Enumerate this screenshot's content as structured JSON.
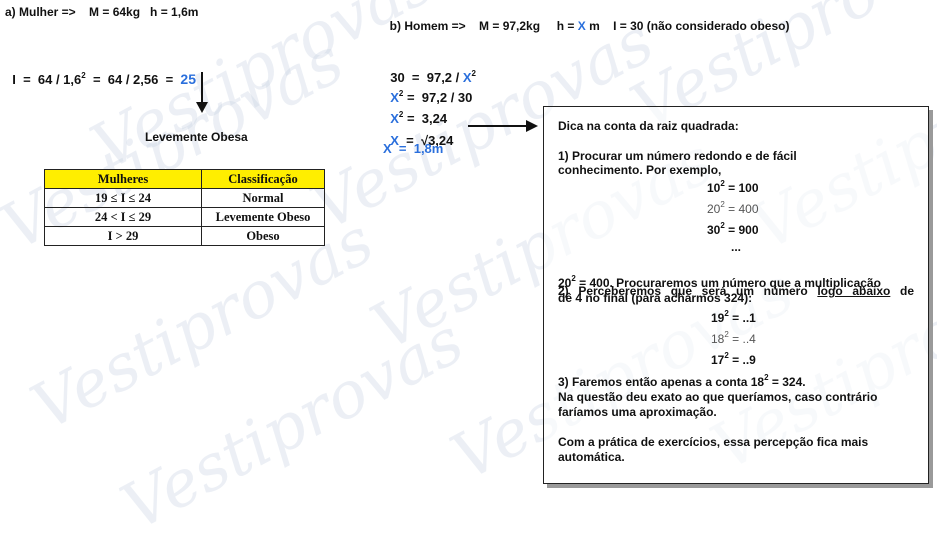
{
  "watermark": "Vestiprovas",
  "part_a": {
    "header": "a) Mulher =>    M = 64kg   h = 1,6m",
    "eq_prefix": "I  =  64 / 1,6",
    "eq_exp": "2",
    "eq_mid": "  =  64 / 2,56  =  ",
    "eq_result": "25",
    "result_label": "Levemente Obesa"
  },
  "table": {
    "headers": [
      "Mulheres",
      "Classificação"
    ],
    "rows": [
      [
        "19  ≤ I  ≤  24",
        "Normal"
      ],
      [
        "24  < I  ≤  29",
        "Levemente Obeso"
      ],
      [
        "I >  29",
        "Obeso"
      ]
    ]
  },
  "part_b": {
    "header_1": "b) Homem =>    M = 97,2kg     h = ",
    "header_x": "X",
    "header_2": " m    I = 30 (não considerado obeso)",
    "line1_a": "30  =  97,2 / ",
    "line1_x": "X",
    "line2_b": " =  97,2 / 30",
    "line3_b": " =  3,24",
    "line4_b": "  =  √3,24",
    "line5": "X  =  1,8m",
    "x": "X",
    "exp": "2"
  },
  "tip": {
    "title": "Dica na conta da raiz quadrada:",
    "p1_l1": "1) Procurar um número redondo e de fácil",
    "p1_l2": "conhecimento. Por exemplo,",
    "sq1": "10",
    "sq1_r": " = 100",
    "sq2": "20",
    "sq2_r": " = 400",
    "sq3": "30",
    "sq3_r": " = 900",
    "ellipsis": "...",
    "p2_l1a": "2)  Perceberemos  que  será  um  número  ",
    "p2_l1u": "logo  abaixo",
    "p2_l1b": "  de",
    "p2_l2a": "20",
    "p2_l2b": " = 400. Procuraremos um número que a multiplicação",
    "p2_l3": "dê 4 no final (para acharmos 324):",
    "sq4": "19",
    "sq4_r": " = ..1",
    "sq5": "18",
    "sq5_r": " = ..4",
    "sq6": "17",
    "sq6_r": " = ..9",
    "p3_l1a": "3) Faremos então apenas a conta 18",
    "p3_l1b": " = 324.",
    "p3_l2": "Na questão deu exato ao que queríamos, caso contrário",
    "p3_l3": "faríamos uma aproximação.",
    "p4_l1": "Com a prática de exercícios, essa percepção fica mais",
    "p4_l2": "automática."
  }
}
